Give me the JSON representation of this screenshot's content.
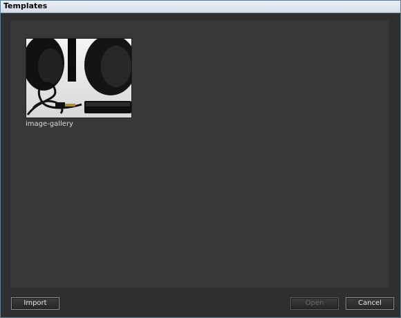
{
  "window": {
    "title": "Templates"
  },
  "templates": [
    {
      "name": "image-gallery",
      "thumbnail": "headphones-photo"
    }
  ],
  "buttons": {
    "import": "Import",
    "open": "Open",
    "cancel": "Cancel"
  },
  "state": {
    "open_enabled": false
  },
  "colors": {
    "background": "#2f2f2f",
    "panel": "#383838",
    "text": "#e6e6e6",
    "title_bar": "#dce4ee"
  }
}
